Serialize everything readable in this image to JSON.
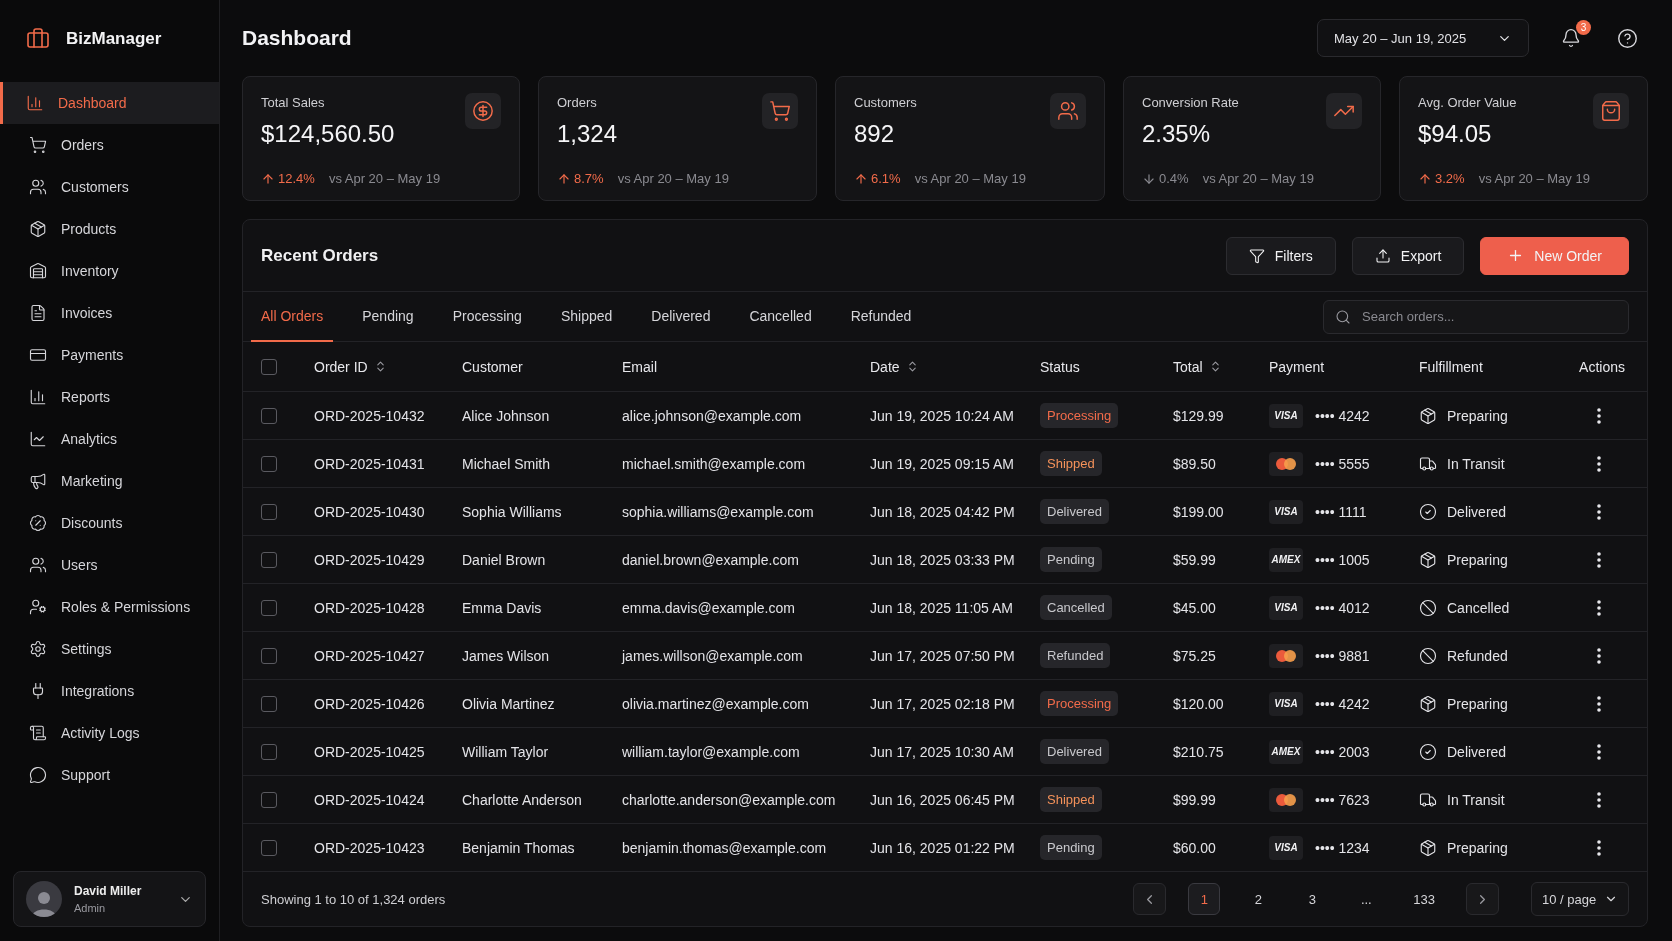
{
  "brand": {
    "name": "BizManager"
  },
  "sidebar": {
    "items": [
      {
        "label": "Dashboard",
        "selected": true
      },
      {
        "label": "Orders",
        "selected": false
      },
      {
        "label": "Customers",
        "selected": false
      },
      {
        "label": "Products",
        "selected": false
      },
      {
        "label": "Inventory",
        "selected": false
      },
      {
        "label": "Invoices",
        "selected": false
      },
      {
        "label": "Payments",
        "selected": false
      },
      {
        "label": "Reports",
        "selected": false
      },
      {
        "label": "Analytics",
        "selected": false
      },
      {
        "label": "Marketing",
        "selected": false
      },
      {
        "label": "Discounts",
        "selected": false
      },
      {
        "label": "Users",
        "selected": false
      },
      {
        "label": "Roles & Permissions",
        "selected": false
      },
      {
        "label": "Settings",
        "selected": false
      },
      {
        "label": "Integrations",
        "selected": false
      },
      {
        "label": "Activity Logs",
        "selected": false
      },
      {
        "label": "Support",
        "selected": false
      }
    ],
    "user": {
      "name": "David Miller",
      "role": "Admin"
    }
  },
  "header": {
    "title": "Dashboard",
    "date_range": "May 20 – Jun 19, 2025",
    "notifications": "3"
  },
  "stats": [
    {
      "label": "Total Sales",
      "value": "$124,560.50",
      "kind": "up",
      "change": "12.4%",
      "period": "vs Apr 20 – May 19"
    },
    {
      "label": "Orders",
      "value": "1,324",
      "kind": "up",
      "change": "8.7%",
      "period": "vs Apr 20 – May 19"
    },
    {
      "label": "Customers",
      "value": "892",
      "kind": "up",
      "change": "6.1%",
      "period": "vs Apr 20 – May 19"
    },
    {
      "label": "Conversion Rate",
      "value": "2.35%",
      "kind": "down",
      "change": "0.4%",
      "period": "vs Apr 20 – May 19"
    },
    {
      "label": "Avg. Order Value",
      "value": "$94.05",
      "kind": "up",
      "change": "3.2%",
      "period": "vs Apr 20 – May 19"
    }
  ],
  "orders": {
    "title": "Recent Orders",
    "buttons": {
      "filters": "Filters",
      "export": "Export",
      "new": "New Order"
    },
    "tabs": [
      {
        "label": "All Orders",
        "selected": true
      },
      {
        "label": "Pending",
        "selected": false
      },
      {
        "label": "Processing",
        "selected": false
      },
      {
        "label": "Shipped",
        "selected": false
      },
      {
        "label": "Delivered",
        "selected": false
      },
      {
        "label": "Cancelled",
        "selected": false
      },
      {
        "label": "Refunded",
        "selected": false
      }
    ],
    "search": {
      "placeholder": "Search orders..."
    },
    "select_all": {
      "checked": false
    },
    "columns": [
      {
        "label": "Order ID",
        "sortable": true
      },
      {
        "label": "Customer",
        "sortable": false
      },
      {
        "label": "Email",
        "sortable": false
      },
      {
        "label": "Date",
        "sortable": true
      },
      {
        "label": "Status",
        "sortable": false
      },
      {
        "label": "Total",
        "sortable": true
      },
      {
        "label": "Payment",
        "sortable": false
      },
      {
        "label": "Fulfillment",
        "sortable": false
      },
      {
        "label": "Actions",
        "sortable": false
      }
    ],
    "rows": [
      {
        "checked": false,
        "id": "ORD-2025-10432",
        "customer": "Alice Johnson",
        "email": "alice.johnson@example.com",
        "date": "Jun 19, 2025 10:24 AM",
        "status": {
          "label": "Processing",
          "color": "#f26b4a"
        },
        "total": "$129.99",
        "payment": {
          "kind": "card",
          "brand": "VISA",
          "number": "•••• 4242"
        },
        "fulfillment": {
          "kind": "preparing",
          "label": "Preparing"
        }
      },
      {
        "checked": false,
        "id": "ORD-2025-10431",
        "customer": "Michael Smith",
        "email": "michael.smith@example.com",
        "date": "Jun 19, 2025 09:15 AM",
        "status": {
          "label": "Shipped",
          "color": "#f5925a"
        },
        "total": "$89.50",
        "payment": {
          "kind": "mastercard",
          "number": "•••• 5555"
        },
        "fulfillment": {
          "kind": "transit",
          "label": "In Transit"
        }
      },
      {
        "checked": false,
        "id": "ORD-2025-10430",
        "customer": "Sophia Williams",
        "email": "sophia.williams@example.com",
        "date": "Jun 18, 2025 04:42 PM",
        "status": {
          "label": "Delivered",
          "color": "#c8c8cc"
        },
        "total": "$199.00",
        "payment": {
          "kind": "card",
          "brand": "VISA",
          "number": "•••• 1111"
        },
        "fulfillment": {
          "kind": "delivered",
          "label": "Delivered"
        }
      },
      {
        "checked": false,
        "id": "ORD-2025-10429",
        "customer": "Daniel Brown",
        "email": "daniel.brown@example.com",
        "date": "Jun 18, 2025 03:33 PM",
        "status": {
          "label": "Pending",
          "color": "#c8c8cc"
        },
        "total": "$59.99",
        "payment": {
          "kind": "card",
          "brand": "AMEX",
          "number": "•••• 1005"
        },
        "fulfillment": {
          "kind": "preparing",
          "label": "Preparing"
        }
      },
      {
        "checked": false,
        "id": "ORD-2025-10428",
        "customer": "Emma Davis",
        "email": "emma.davis@example.com",
        "date": "Jun 18, 2025 11:05 AM",
        "status": {
          "label": "Cancelled",
          "color": "#c8c8cc"
        },
        "total": "$45.00",
        "payment": {
          "kind": "card",
          "brand": "VISA",
          "number": "•••• 4012"
        },
        "fulfillment": {
          "kind": "cancelled",
          "label": "Cancelled"
        }
      },
      {
        "checked": false,
        "id": "ORD-2025-10427",
        "customer": "James Wilson",
        "email": "james.willson@example.com",
        "date": "Jun 17, 2025 07:50 PM",
        "status": {
          "label": "Refunded",
          "color": "#c8c8cc"
        },
        "total": "$75.25",
        "payment": {
          "kind": "mastercard",
          "number": "•••• 9881"
        },
        "fulfillment": {
          "kind": "cancelled",
          "label": "Refunded"
        }
      },
      {
        "checked": false,
        "id": "ORD-2025-10426",
        "customer": "Olivia Martinez",
        "email": "olivia.martinez@example.com",
        "date": "Jun 17, 2025 02:18 PM",
        "status": {
          "label": "Processing",
          "color": "#f26b4a"
        },
        "total": "$120.00",
        "payment": {
          "kind": "card",
          "brand": "VISA",
          "number": "•••• 4242"
        },
        "fulfillment": {
          "kind": "preparing",
          "label": "Preparing"
        }
      },
      {
        "checked": false,
        "id": "ORD-2025-10425",
        "customer": "William Taylor",
        "email": "william.taylor@example.com",
        "date": "Jun 17, 2025 10:30 AM",
        "status": {
          "label": "Delivered",
          "color": "#c8c8cc"
        },
        "total": "$210.75",
        "payment": {
          "kind": "card",
          "brand": "AMEX",
          "number": "•••• 2003"
        },
        "fulfillment": {
          "kind": "delivered",
          "label": "Delivered"
        }
      },
      {
        "checked": false,
        "id": "ORD-2025-10424",
        "customer": "Charlotte Anderson",
        "email": "charlotte.anderson@example.com",
        "date": "Jun 16, 2025 06:45 PM",
        "status": {
          "label": "Shipped",
          "color": "#f5925a"
        },
        "total": "$99.99",
        "payment": {
          "kind": "mastercard",
          "number": "•••• 7623"
        },
        "fulfillment": {
          "kind": "transit",
          "label": "In Transit"
        }
      },
      {
        "checked": false,
        "id": "ORD-2025-10423",
        "customer": "Benjamin Thomas",
        "email": "benjamin.thomas@example.com",
        "date": "Jun 16, 2025 01:22 PM",
        "status": {
          "label": "Pending",
          "color": "#c8c8cc"
        },
        "total": "$60.00",
        "payment": {
          "kind": "card",
          "brand": "VISA",
          "number": "•••• 1234"
        },
        "fulfillment": {
          "kind": "preparing",
          "label": "Preparing"
        }
      }
    ],
    "footer": {
      "summary": "Showing 1 to 10 of 1,324 orders",
      "pages": [
        {
          "label": "1",
          "selected": true
        },
        {
          "label": "2",
          "selected": false
        },
        {
          "label": "3",
          "selected": false
        },
        {
          "label": "...",
          "selected": false
        },
        {
          "label": "133",
          "selected": false
        }
      ],
      "page_size": "10 / page"
    }
  }
}
